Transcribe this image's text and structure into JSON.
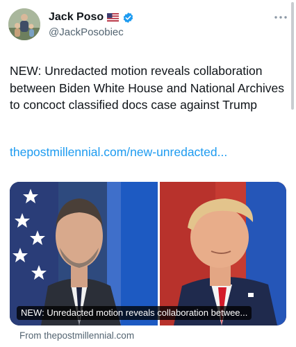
{
  "author": {
    "display_name": "Jack Poso",
    "handle": "@JackPosobiec",
    "flag_icon": "us-flag-icon",
    "verified_icon": "verified-badge-icon",
    "verified_color": "#1d9bf0"
  },
  "more_icon": "more-options-icon",
  "tweet": {
    "text": "NEW: Unredacted motion reveals collaboration between Biden White House and National Archives to concoct classified docs case against Trump",
    "link_text": "thepostmillennial.com/new-unredacted..."
  },
  "card": {
    "title": "NEW: Unredacted motion reveals collaboration betwee...",
    "source": "From thepostmillennial.com"
  },
  "colors": {
    "link": "#1d9bf0",
    "secondary_text": "#536471"
  }
}
